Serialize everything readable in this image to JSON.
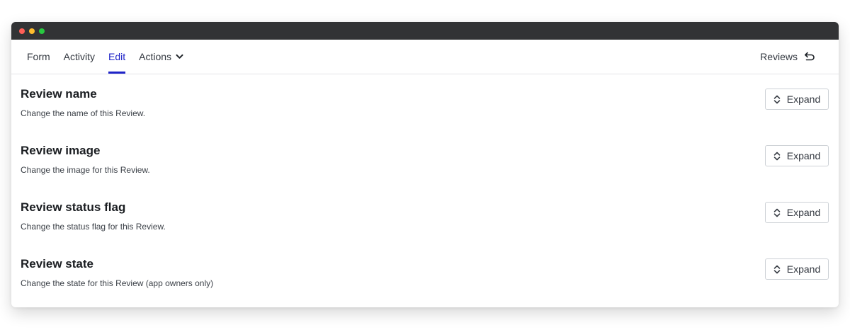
{
  "window": {
    "traffic_lights": [
      {
        "name": "close",
        "color": "#ff5f57"
      },
      {
        "name": "minimize",
        "color": "#febc2e"
      },
      {
        "name": "maximize",
        "color": "#28c840"
      }
    ]
  },
  "nav": {
    "tabs": [
      {
        "label": "Form",
        "active": false
      },
      {
        "label": "Activity",
        "active": false
      },
      {
        "label": "Edit",
        "active": true
      },
      {
        "label": "Actions",
        "active": false,
        "dropdown": true
      }
    ],
    "right_label": "Reviews",
    "right_icon": "return-arrow-icon",
    "accent_color": "#1f24c8"
  },
  "sections": [
    {
      "title": "Review name",
      "description": "Change the name of this Review.",
      "button_label": "Expand"
    },
    {
      "title": "Review image",
      "description": "Change the image for this Review.",
      "button_label": "Expand"
    },
    {
      "title": "Review status flag",
      "description": "Change the status flag for this Review.",
      "button_label": "Expand"
    },
    {
      "title": "Review state",
      "description": "Change the state for this Review (app owners only)",
      "button_label": "Expand"
    }
  ]
}
